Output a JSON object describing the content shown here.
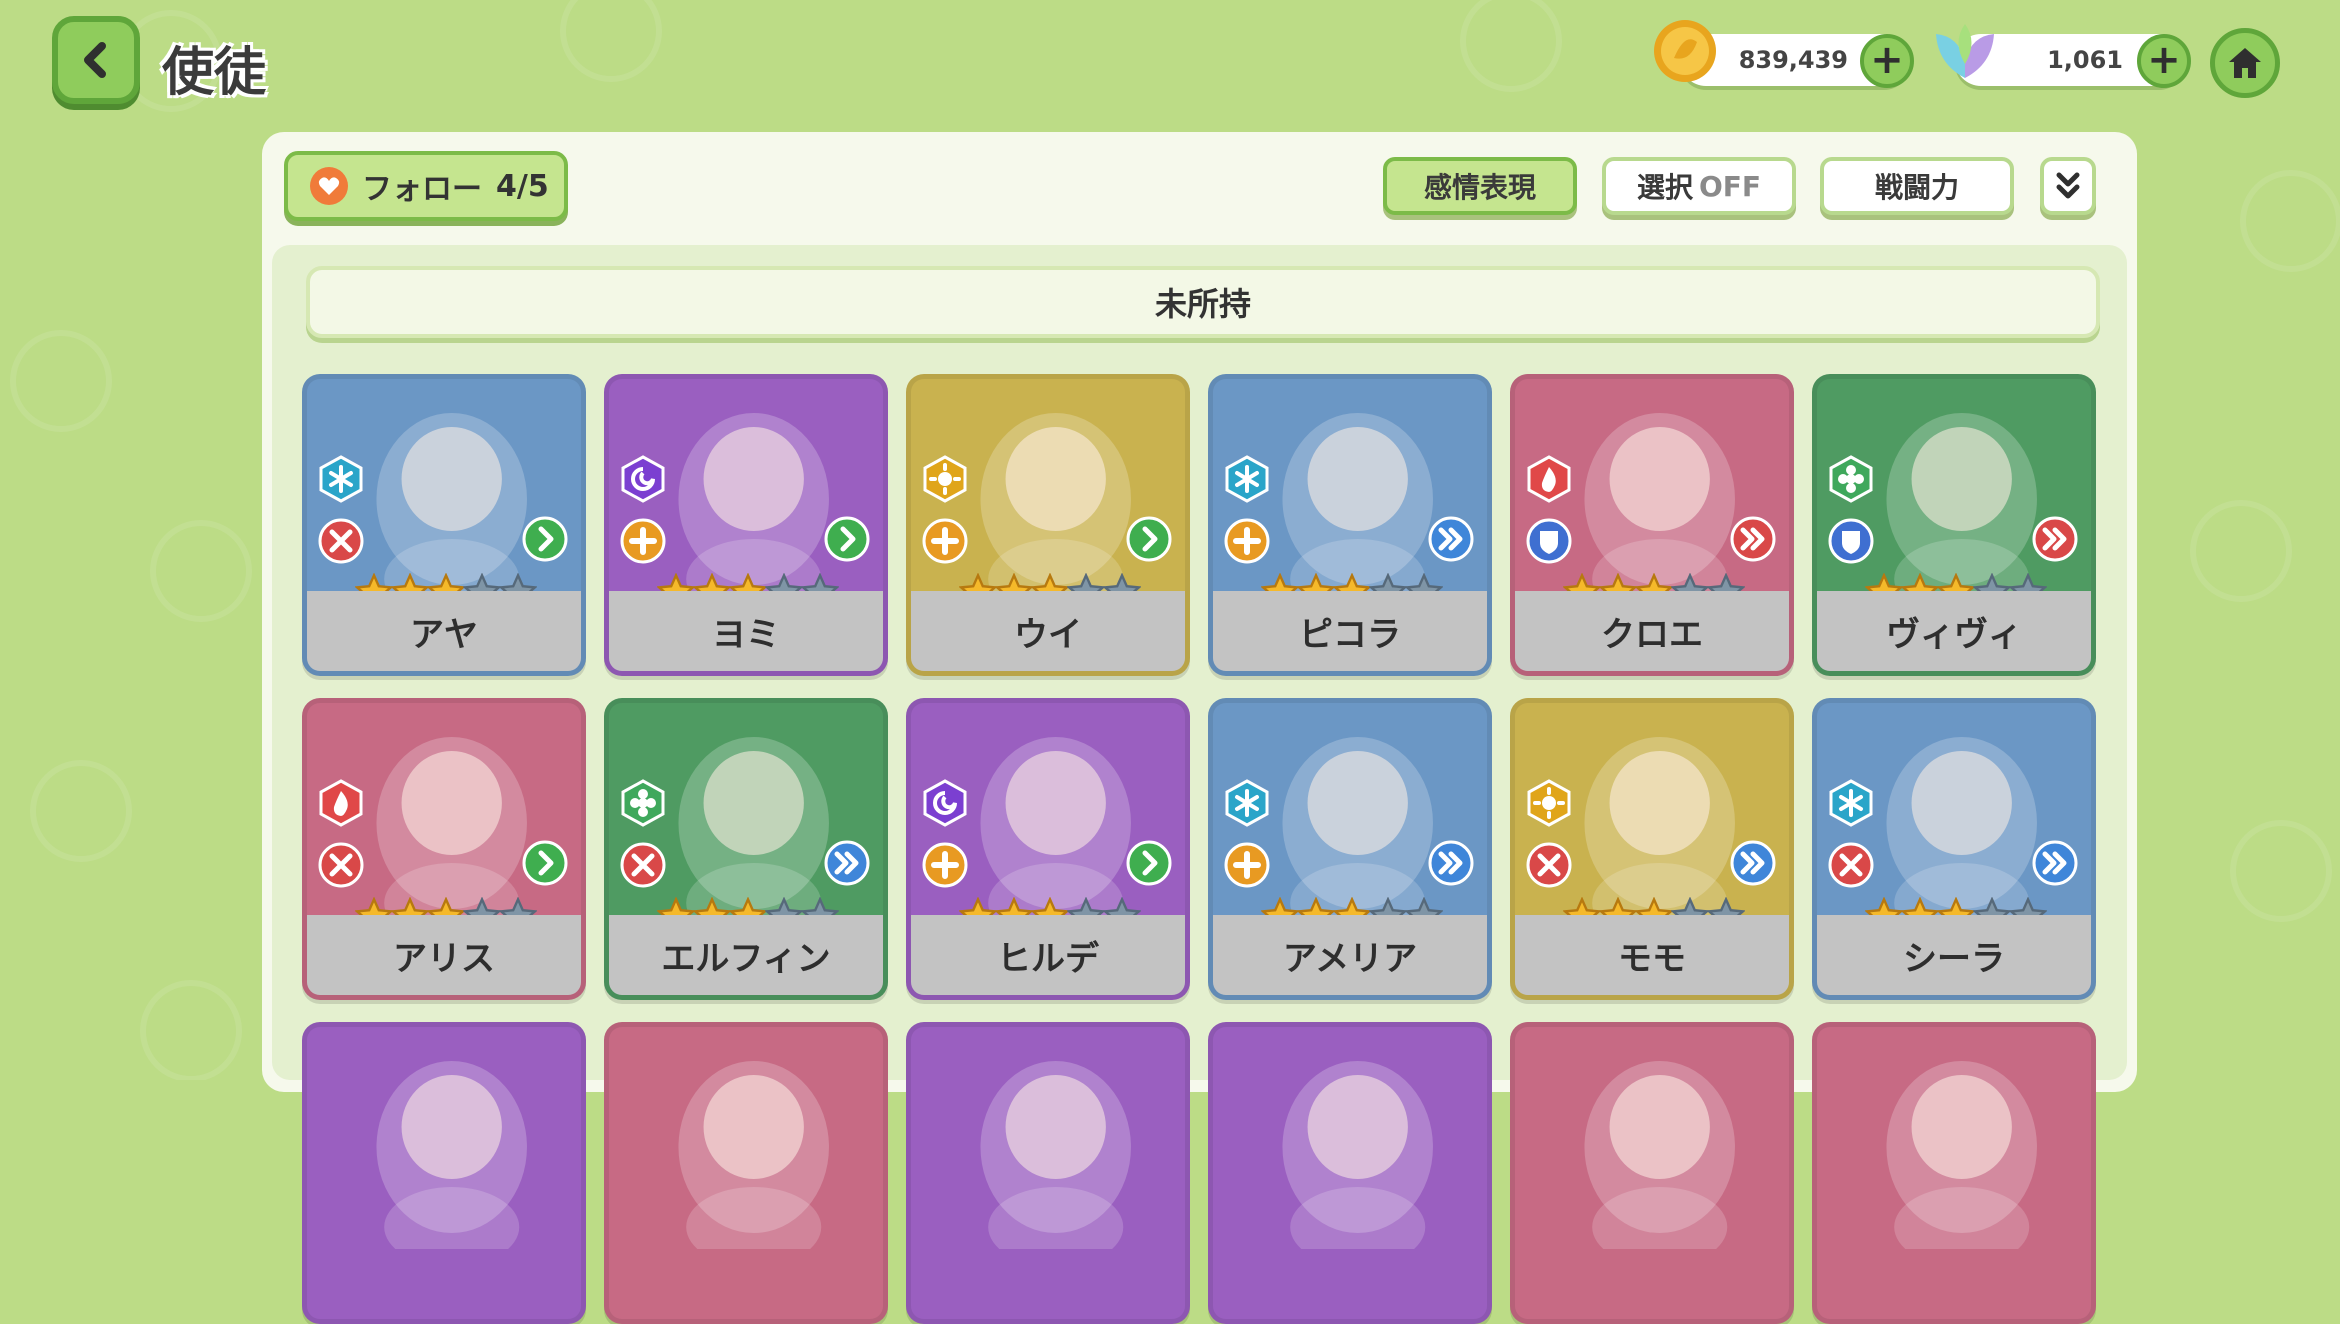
{
  "header": {
    "title": "使徒",
    "gold_amount": "839,439",
    "leaf_amount": "1,061"
  },
  "toolbar": {
    "follow_label": "フォロー",
    "follow_count": "4/5",
    "emotion_label": "感情表現",
    "select_label": "選択",
    "select_state": "OFF",
    "power_label": "戦闘力"
  },
  "section": {
    "title": "未所持"
  },
  "characters": [
    {
      "name": "アヤ",
      "bg": "blue",
      "element": "ice",
      "role": "attack",
      "arrow": "green",
      "stars": 3
    },
    {
      "name": "ヨミ",
      "bg": "purple",
      "element": "dark",
      "role": "support",
      "arrow": "green",
      "stars": 3
    },
    {
      "name": "ウイ",
      "bg": "yellow",
      "element": "light",
      "role": "support",
      "arrow": "green",
      "stars": 3
    },
    {
      "name": "ピコラ",
      "bg": "blue",
      "element": "ice",
      "role": "support",
      "arrow": "blue",
      "stars": 3
    },
    {
      "name": "クロエ",
      "bg": "pink",
      "element": "fire",
      "role": "defense",
      "arrow": "red",
      "stars": 3
    },
    {
      "name": "ヴィヴィ",
      "bg": "green",
      "element": "wind",
      "role": "defense",
      "arrow": "red",
      "stars": 3
    },
    {
      "name": "アリス",
      "bg": "pink",
      "element": "fire",
      "role": "attack",
      "arrow": "green",
      "stars": 3
    },
    {
      "name": "エルフィン",
      "bg": "green",
      "element": "wind",
      "role": "attack",
      "arrow": "blue",
      "stars": 3
    },
    {
      "name": "ヒルデ",
      "bg": "purple",
      "element": "dark",
      "role": "support",
      "arrow": "green",
      "stars": 3
    },
    {
      "name": "アメリア",
      "bg": "blue",
      "element": "ice",
      "role": "support",
      "arrow": "blue",
      "stars": 3
    },
    {
      "name": "モモ",
      "bg": "yellow",
      "element": "light",
      "role": "attack",
      "arrow": "blue",
      "stars": 3
    },
    {
      "name": "シーラ",
      "bg": "blue",
      "element": "ice",
      "role": "attack",
      "arrow": "blue",
      "stars": 3
    },
    {
      "name": "",
      "bg": "purple",
      "element": "",
      "role": "",
      "arrow": "",
      "stars": 0
    },
    {
      "name": "",
      "bg": "pink",
      "element": "",
      "role": "",
      "arrow": "",
      "stars": 0
    },
    {
      "name": "",
      "bg": "purple",
      "element": "",
      "role": "",
      "arrow": "",
      "stars": 0
    },
    {
      "name": "",
      "bg": "purple",
      "element": "",
      "role": "",
      "arrow": "",
      "stars": 0
    },
    {
      "name": "",
      "bg": "pink",
      "element": "",
      "role": "",
      "arrow": "",
      "stars": 0
    },
    {
      "name": "",
      "bg": "pink",
      "element": "",
      "role": "",
      "arrow": "",
      "stars": 0
    }
  ],
  "max_stars": 5,
  "colors": {
    "background": "#bcdc86",
    "accent_green": "#8fcc5c",
    "blue": "#6b97c5",
    "purple": "#9a5fc0",
    "yellow": "#c9b24f",
    "pink": "#c76a84",
    "green": "#4f9b62"
  }
}
